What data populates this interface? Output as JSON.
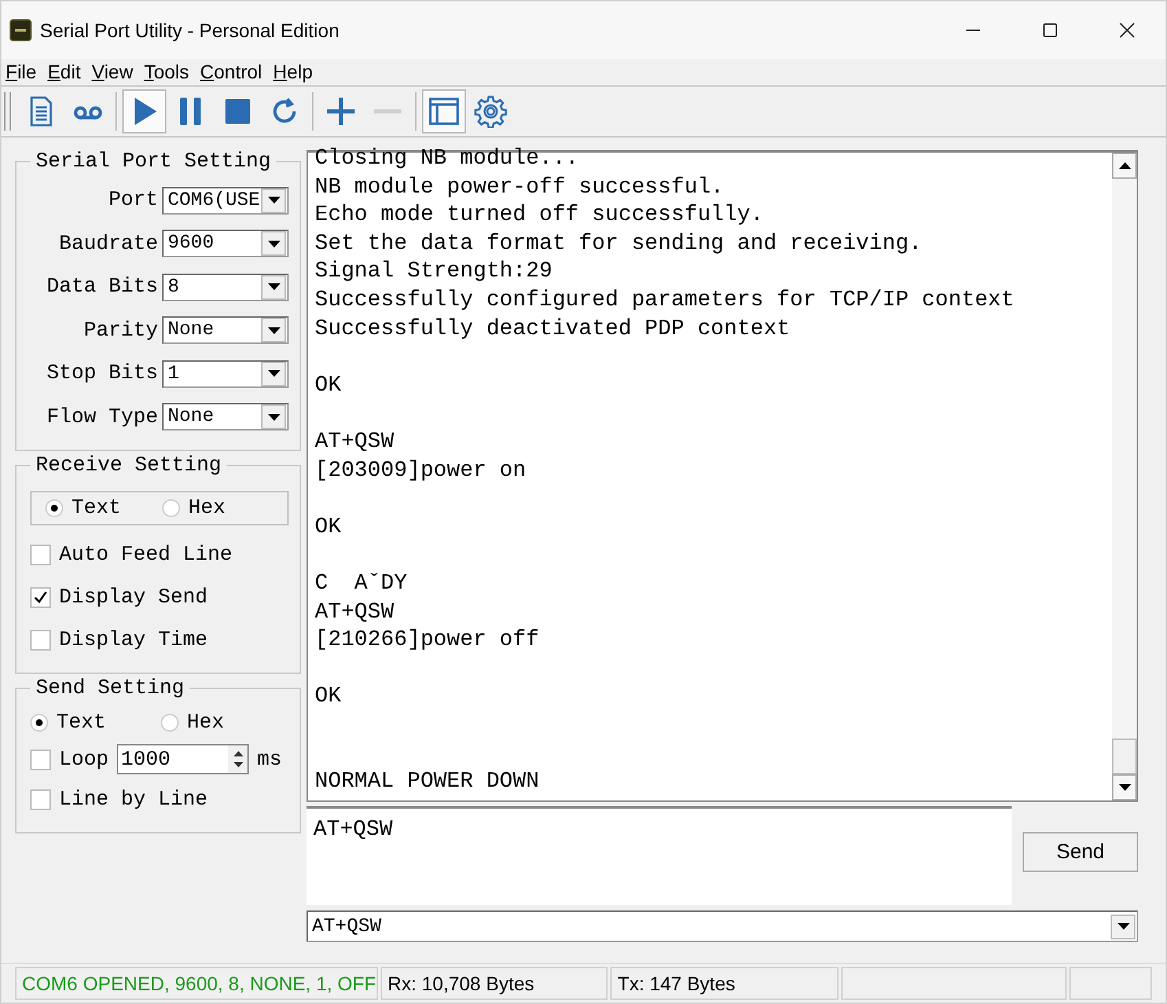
{
  "window": {
    "title": "Serial Port Utility - Personal Edition"
  },
  "menu": [
    {
      "label": "File"
    },
    {
      "label": "Edit"
    },
    {
      "label": "View"
    },
    {
      "label": "Tools"
    },
    {
      "label": "Control"
    },
    {
      "label": "Help"
    }
  ],
  "toolbar": [
    {
      "pressed": false,
      "disabled": false
    },
    {
      "pressed": false,
      "disabled": false
    },
    {
      "pressed": true,
      "disabled": false
    },
    {
      "pressed": false,
      "disabled": false
    },
    {
      "pressed": false,
      "disabled": false
    },
    {
      "pressed": false,
      "disabled": false
    },
    {
      "pressed": false,
      "disabled": false
    },
    {
      "pressed": false,
      "disabled": true
    },
    {
      "pressed": true,
      "disabled": false
    },
    {
      "pressed": false,
      "disabled": false
    }
  ],
  "serial_port_setting": {
    "title": "Serial Port Setting",
    "fields": [
      {
        "label": "Port",
        "value": "COM6(USE"
      },
      {
        "label": "Baudrate",
        "value": "9600"
      },
      {
        "label": "Data Bits",
        "value": "8"
      },
      {
        "label": "Parity",
        "value": "None"
      },
      {
        "label": "Stop Bits",
        "value": "1"
      },
      {
        "label": "Flow Type",
        "value": "None"
      }
    ]
  },
  "receive_setting": {
    "title": "Receive Setting",
    "modes": [
      {
        "label": "Text",
        "selected": true
      },
      {
        "label": "Hex",
        "selected": false
      }
    ],
    "options": [
      {
        "label": "Auto Feed Line",
        "checked": false
      },
      {
        "label": "Display Send",
        "checked": true
      },
      {
        "label": "Display Time",
        "checked": false
      }
    ]
  },
  "send_setting": {
    "title": "Send Setting",
    "modes": [
      {
        "label": "Text",
        "selected": true
      },
      {
        "label": "Hex",
        "selected": false
      }
    ],
    "loop": {
      "label": "Loop",
      "checked": false,
      "value": "1000",
      "unit": "ms"
    },
    "line_by_line": {
      "label": "Line by Line",
      "checked": false
    }
  },
  "receive_log": "Closing NB module...\nNB module power-off successful.\nEcho mode turned off successfully.\nSet the data format for sending and receiving.\nSignal Strength:29\nSuccessfully configured parameters for TCP/IP context\nSuccessfully deactivated PDP context\n\nOK\n\nAT+QSW\n[203009]power on\n\nOK\n\nC  AˇDY\nAT+QSW\n[210266]power off\n\nOK\n\n\nNORMAL POWER DOWN",
  "send_text": "AT+QSW",
  "send_button": "Send",
  "history_combo": "AT+QSW",
  "status_bar": [
    "COM6 OPENED, 9600, 8, NONE, 1, OFF",
    "Rx: 10,708 Bytes",
    "Tx: 147 Bytes"
  ]
}
